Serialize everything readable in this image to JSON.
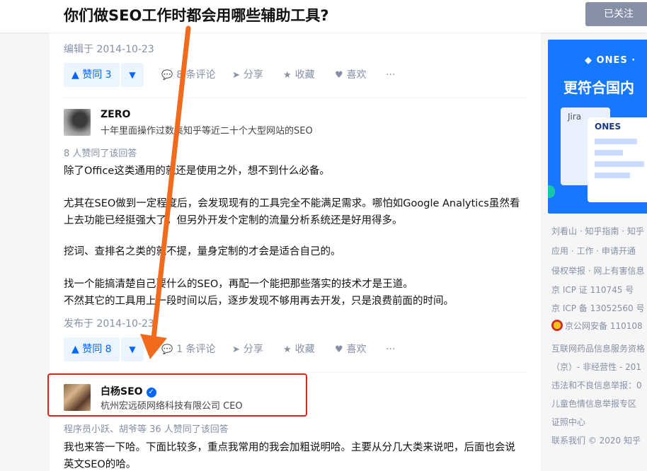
{
  "question": {
    "title": "你们做SEO工作时都会用哪些辅助工具?",
    "follow_label": "已关注"
  },
  "answer_prev": {
    "edited": "编辑于 2014-10-23",
    "vote_up": "▲ 赞同 3",
    "comments": "8 条评论",
    "share": "分享",
    "favorite": "收藏",
    "like": "喜欢",
    "more": "···"
  },
  "answer_zero": {
    "author": {
      "name": "ZERO",
      "bio": "十年里面操作过数集知乎等近二十个大型网站的SEO"
    },
    "voters": "8 人赞同了该回答",
    "paragraphs": [
      "除了Office这类通用的就还是使用之外，想不到什么必备。",
      "尤其在SEO做到一定程度后，会发现现有的工具完全不能满足需求。哪怕如Google Analytics虽然看上去功能已经挺强大了，但另外开发个定制的流量分析系统还是好用得多。",
      "挖词、查排名之类的就不提，量身定制的才会是适合自己的。",
      "找一个能搞清楚自己要什么的SEO，再配一个能把那些落实的技术才是王道。",
      "不然其它的工具用上一段时间以后，逐步发现不够用再去开发，只是浪费前面的时间。"
    ],
    "published": "发布于 2014-10-23",
    "vote_up": "▲ 赞同 8",
    "comments": "1 条评论",
    "share": "分享",
    "favorite": "收藏",
    "like": "喜欢",
    "more": "···"
  },
  "answer_baiyang": {
    "author": {
      "name": "白杨SEO",
      "bio": "杭州宏远硕网络科技有限公司 CEO"
    },
    "voters": "程序员小跃、胡爷等 36 人赞同了该回答",
    "paragraph": "我也来答一下哈。下面比较多，重点我常用的我会加粗说明哈。主要从分几大类来说吧，后面也会说英文SEO的哈。"
  },
  "ad": {
    "brand": "◆ ONES ·",
    "slogan": "更符合国内",
    "card_left": "Jira",
    "card_right": "ONES"
  },
  "footer": [
    "刘看山 · 知乎指南 · 知乎",
    "应用 · 工作 · 申请开通",
    "侵权举报 · 网上有害信息",
    "京 ICP 证 110745 号",
    "京 ICP 备 13052560 号",
    "京公网安备 110108",
    "互联网药品信息服务资格",
    "（京）- 非经营性 - 201",
    "违法和不良信息举报：0",
    "儿童色情信息举报专区",
    "证照中心",
    "联系我们 © 2020 知乎"
  ],
  "colors": {
    "accent": "#0066ff",
    "annotation": "#f26a1b",
    "highlight": "#e02020",
    "muted": "#8590a6"
  }
}
